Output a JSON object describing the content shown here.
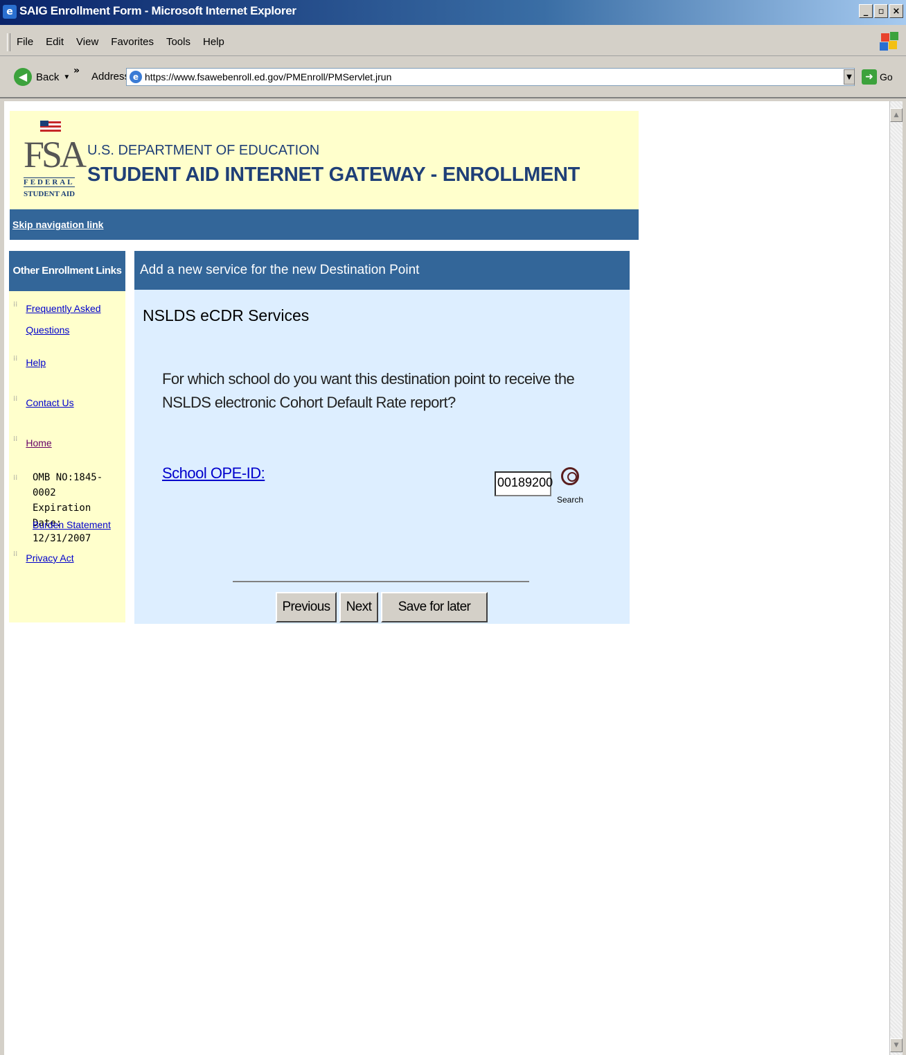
{
  "window": {
    "title": "SAIG Enrollment Form - Microsoft Internet Explorer"
  },
  "menu": [
    "File",
    "Edit",
    "View",
    "Favorites",
    "Tools",
    "Help"
  ],
  "toolbar": {
    "back_label": "Back",
    "address_label": "Address",
    "go_label": "Go"
  },
  "address": {
    "url": "https://www.fsawebenroll.ed.gov/PMEnroll/PMServlet.jrun"
  },
  "header": {
    "logo_letters": "FSA",
    "logo_federal": "FEDERAL",
    "logo_student_aid": "STUDENT AID",
    "dept": "U.S. DEPARTMENT OF EDUCATION",
    "title": "STUDENT AID INTERNET GATEWAY - ENROLLMENT",
    "skip_link": "Skip navigation link"
  },
  "sidebar": {
    "heading": "Other Enrollment Links",
    "faq_line1": "Frequently Asked",
    "faq_line2": "Questions",
    "help": "Help",
    "contact": "Contact Us",
    "home": "Home",
    "omb_no": "OMB NO:1845-0002",
    "expiration_label": "Expiration Date:",
    "expiration_date": "12/31/2007",
    "burden": "Burden Statement",
    "privacy": "Privacy Act"
  },
  "main": {
    "heading": "Add a new service for the new Destination Point",
    "section_title": "NSLDS eCDR Services",
    "question": "For which school do you want this destination point to receive the NSLDS electronic Cohort Default Rate report?",
    "ope_label": "School OPE-ID:",
    "ope_value": "00189200",
    "search_label": "Search",
    "buttons": {
      "previous": "Previous",
      "next": "Next",
      "save": "Save for later"
    }
  }
}
